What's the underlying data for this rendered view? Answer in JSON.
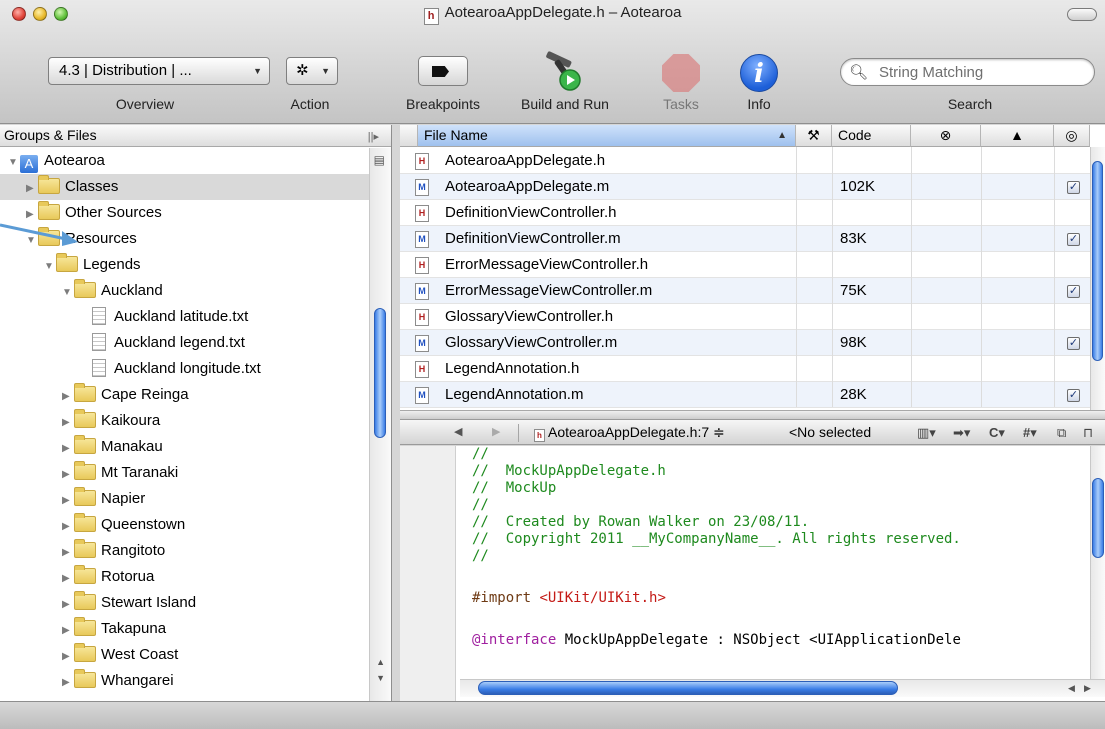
{
  "window": {
    "title": "AotearoaAppDelegate.h – Aotearoa",
    "doc_icon_letter": "h"
  },
  "toolbar": {
    "overview_popup": "4.3 | Distribution | ...",
    "overview_label": "Overview",
    "action_label": "Action",
    "breakpoints_label": "Breakpoints",
    "build_run_label": "Build and Run",
    "tasks_label": "Tasks",
    "info_label": "Info",
    "search_placeholder": "String Matching",
    "search_label": "Search"
  },
  "sidebar": {
    "header": "Groups & Files",
    "items": [
      {
        "label": "Aotearoa",
        "kind": "project",
        "expanded": true
      },
      {
        "label": "Classes",
        "kind": "folder",
        "expanded": false,
        "selected": true
      },
      {
        "label": "Other Sources",
        "kind": "folder",
        "expanded": false
      },
      {
        "label": "Resources",
        "kind": "folder",
        "expanded": true
      },
      {
        "label": "Legends",
        "kind": "folder",
        "expanded": true
      },
      {
        "label": "Auckland",
        "kind": "folder",
        "expanded": true
      },
      {
        "label": "Auckland latitude.txt",
        "kind": "file"
      },
      {
        "label": "Auckland legend.txt",
        "kind": "file"
      },
      {
        "label": "Auckland longitude.txt",
        "kind": "file"
      },
      {
        "label": "Cape Reinga",
        "kind": "folder",
        "expanded": false
      },
      {
        "label": "Kaikoura",
        "kind": "folder",
        "expanded": false
      },
      {
        "label": "Manakau",
        "kind": "folder",
        "expanded": false
      },
      {
        "label": "Mt Taranaki",
        "kind": "folder",
        "expanded": false
      },
      {
        "label": "Napier",
        "kind": "folder",
        "expanded": false
      },
      {
        "label": "Queenstown",
        "kind": "folder",
        "expanded": false
      },
      {
        "label": "Rangitoto",
        "kind": "folder",
        "expanded": false
      },
      {
        "label": "Rotorua",
        "kind": "folder",
        "expanded": false
      },
      {
        "label": "Stewart Island",
        "kind": "folder",
        "expanded": false
      },
      {
        "label": "Takapuna",
        "kind": "folder",
        "expanded": false
      },
      {
        "label": "West Coast",
        "kind": "folder",
        "expanded": false
      },
      {
        "label": "Whangarei",
        "kind": "folder",
        "expanded": false
      }
    ]
  },
  "file_table": {
    "columns": {
      "file_name": "File Name",
      "code": "Code"
    },
    "sort_indicator": "▲",
    "rows": [
      {
        "icon": "H",
        "name": "AotearoaAppDelegate.h",
        "code": "",
        "checked": false
      },
      {
        "icon": "M",
        "name": "AotearoaAppDelegate.m",
        "code": "102K",
        "checked": true
      },
      {
        "icon": "H",
        "name": "DefinitionViewController.h",
        "code": "",
        "checked": false
      },
      {
        "icon": "M",
        "name": "DefinitionViewController.m",
        "code": "83K",
        "checked": true
      },
      {
        "icon": "H",
        "name": "ErrorMessageViewController.h",
        "code": "",
        "checked": false
      },
      {
        "icon": "M",
        "name": "ErrorMessageViewController.m",
        "code": "75K",
        "checked": true
      },
      {
        "icon": "H",
        "name": "GlossaryViewController.h",
        "code": "",
        "checked": false
      },
      {
        "icon": "M",
        "name": "GlossaryViewController.m",
        "code": "98K",
        "checked": true
      },
      {
        "icon": "H",
        "name": "LegendAnnotation.h",
        "code": "",
        "checked": false
      },
      {
        "icon": "M",
        "name": "LegendAnnotation.m",
        "code": "28K",
        "checked": true
      }
    ]
  },
  "editor": {
    "file_popup": "AotearoaAppDelegate.h:7 ≑",
    "symbol_popup": "<No selected",
    "lines": [
      {
        "type": "comment",
        "text": "//"
      },
      {
        "type": "comment",
        "text": "//  MockUpAppDelegate.h"
      },
      {
        "type": "comment",
        "text": "//  MockUp"
      },
      {
        "type": "comment",
        "text": "//"
      },
      {
        "type": "comment",
        "text": "//  Created by Rowan Walker on 23/08/11."
      },
      {
        "type": "comment",
        "text": "//  Copyright 2011 __MyCompanyName__. All rights reserved."
      },
      {
        "type": "comment",
        "text": "//"
      },
      {
        "type": "blank",
        "text": ""
      },
      {
        "type": "import",
        "directive": "#import ",
        "path": "<UIKit/UIKit.h>"
      },
      {
        "type": "blank",
        "text": ""
      },
      {
        "type": "interface",
        "keyword": "@interface",
        "rest": " MockUpAppDelegate : NSObject <UIApplicationDele"
      }
    ]
  },
  "colors": {
    "comment": "#1e8a1e",
    "string": "#c41a16",
    "keyword": "#a020a0",
    "selection_blue": "#3a7de6"
  }
}
